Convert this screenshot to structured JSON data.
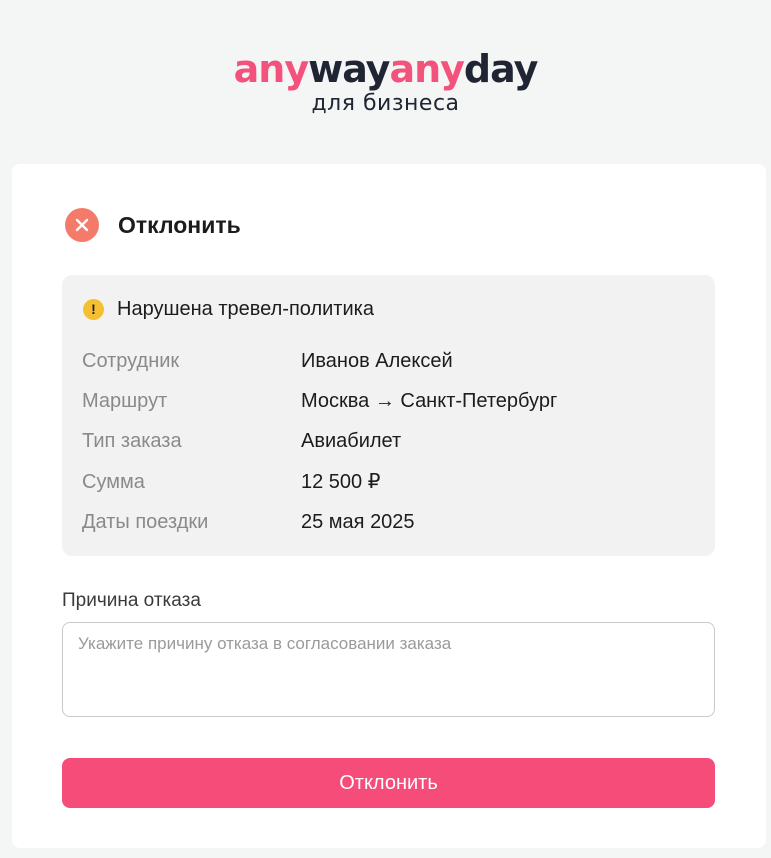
{
  "brand": {
    "logo_parts": [
      "any",
      "way",
      "any",
      "day"
    ],
    "subtitle": "для бизнеса",
    "colors": {
      "pink": "#f2527c",
      "dark": "#1f2533"
    }
  },
  "dialog": {
    "title": "Отклонить",
    "title_icon": "close-circle-icon",
    "warning": {
      "icon": "exclamation-icon",
      "text": "Нарушена тревел-политика"
    },
    "details": [
      {
        "label": "Сотрудник",
        "value": "Иванов Алексей"
      },
      {
        "label": "Маршрут",
        "value": "Москва → Санкт-Петербург"
      },
      {
        "label": "Тип заказа",
        "value": "Авиабилет"
      },
      {
        "label": "Сумма",
        "value": "12 500 ₽"
      },
      {
        "label": "Даты поездки",
        "value": "25 мая 2025"
      }
    ],
    "reason": {
      "label": "Причина отказа",
      "value": "",
      "placeholder": "Укажите причину отказа в согласовании заказа"
    },
    "submit_label": "Отклонить",
    "accent_color": "#f64c7a"
  }
}
